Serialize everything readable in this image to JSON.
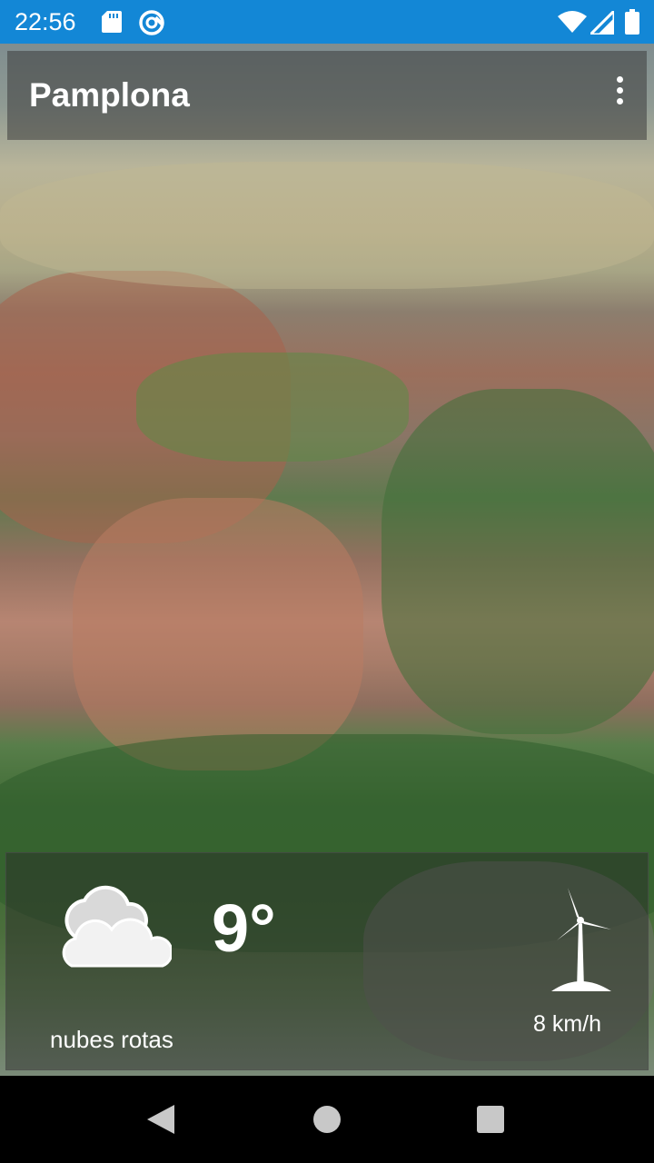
{
  "status_bar": {
    "time": "22:56",
    "background_color": "#1387d6",
    "icons": [
      "sd-card-icon",
      "sync-icon",
      "wifi-icon",
      "signal-icon",
      "battery-icon"
    ]
  },
  "app_bar": {
    "title": "Pamplona",
    "menu_icon": "overflow-menu-icon"
  },
  "weather": {
    "condition_icon": "cloud-icon",
    "temperature": "9°",
    "description": "nubes rotas",
    "wind_icon": "wind-turbine-icon",
    "wind_speed": "8 km/h"
  },
  "nav_bar": {
    "icons": [
      "back-icon",
      "home-icon",
      "recents-icon"
    ]
  }
}
